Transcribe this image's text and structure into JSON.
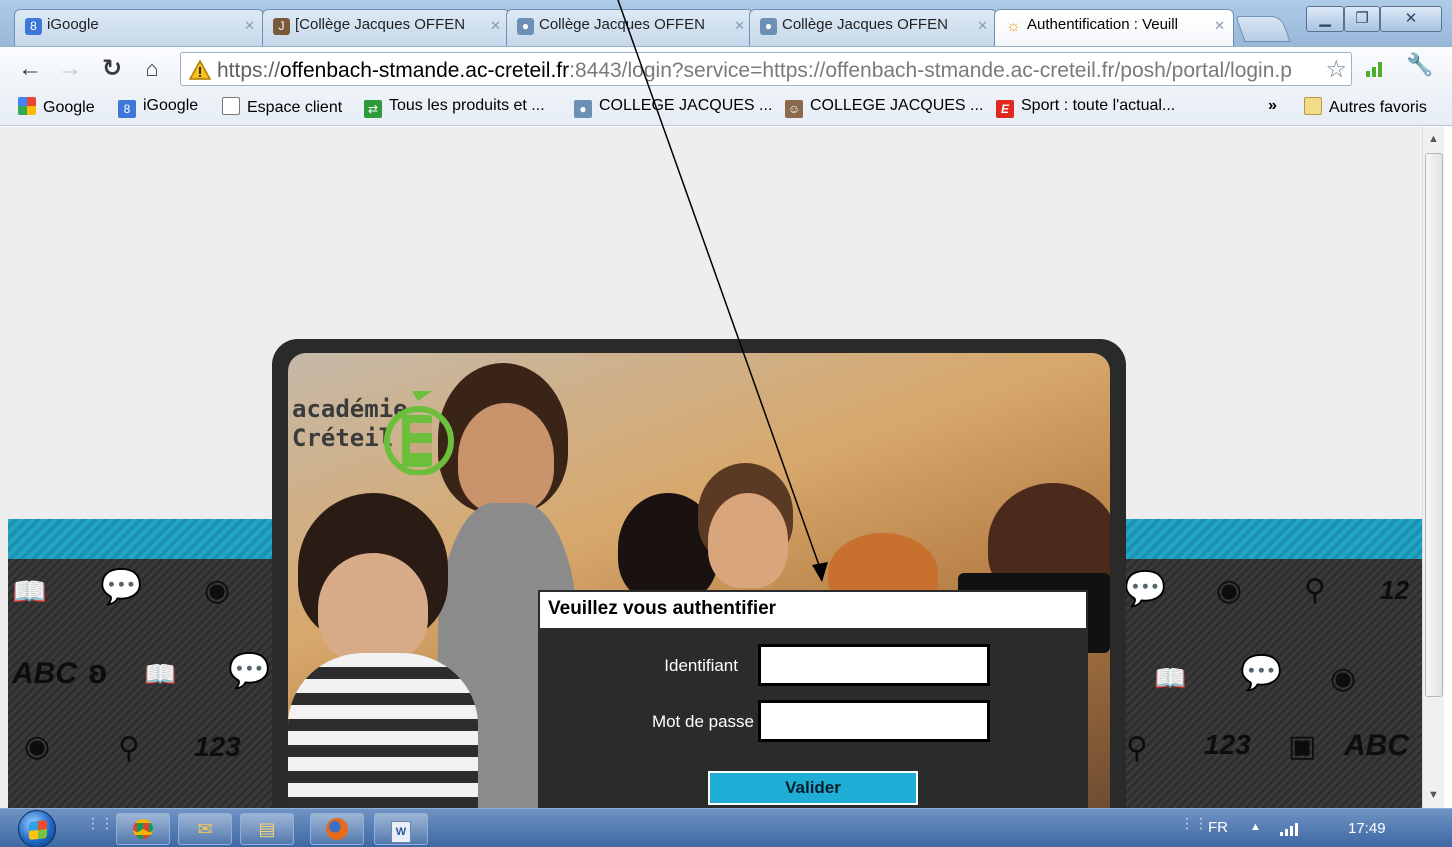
{
  "tabs": [
    {
      "label": "iGoogle",
      "icon": "google-8-icon",
      "color": "#3d78d8"
    },
    {
      "label": "[Collège Jacques OFFEN",
      "icon": "college-logo-icon",
      "color": "#7a5a3a"
    },
    {
      "label": "Collège Jacques OFFEN",
      "icon": "owl-icon",
      "color": "#6b8fb5"
    },
    {
      "label": "Collège Jacques OFFEN",
      "icon": "owl-icon",
      "color": "#6b8fb5"
    },
    {
      "label": "Authentification : Veuill",
      "icon": "loading-sun-icon",
      "color": "#f0a020",
      "active": true
    }
  ],
  "toolbar": {
    "url_scheme": "https://",
    "url_host": "offenbach-stmande.ac-creteil.fr",
    "url_rest": ":8443/login?service=https://offenbach-stmande.ac-creteil.fr/posh/portal/login.p"
  },
  "bookmarks": [
    {
      "label": "Google",
      "icon": "google-puzzle-icon",
      "color": "#4285f4"
    },
    {
      "label": "iGoogle",
      "icon": "google-8-icon",
      "color": "#3d78d8"
    },
    {
      "label": "Espace client",
      "icon": "page-icon",
      "color": "#ffffff"
    },
    {
      "label": "Tous les produits et ...",
      "icon": "green-arrows-icon",
      "color": "#2e9a3c"
    },
    {
      "label": "COLLEGE JACQUES ...",
      "icon": "owl-icon",
      "color": "#6b8fb5"
    },
    {
      "label": "COLLEGE JACQUES ...",
      "icon": "mascot-icon",
      "color": "#8a6a4a"
    },
    {
      "label": "Sport : toute l'actual...",
      "icon": "lequipe-e-icon",
      "color": "#e0281e"
    }
  ],
  "bookmarks_overflow": "»",
  "other_bookmarks": "Autres favoris",
  "logo": {
    "line1": "académie",
    "line2": "Créteil",
    "letter": "E",
    "color": "#6cbf3a"
  },
  "login": {
    "title": "Veuillez vous authentifier",
    "username_label": "Identifiant",
    "password_label": "Mot de passe",
    "username_value": "",
    "password_value": "",
    "submit_label": "Valider",
    "button_color": "#1eaed6"
  },
  "taskbar": {
    "items": [
      "chrome-icon",
      "outlook-icon",
      "file-explorer-icon",
      "firefox-icon",
      "word-icon"
    ],
    "language": "FR",
    "clock": "17:49"
  },
  "colors": {
    "stripe": "#22a6c6",
    "page_bg": "#eeeeee",
    "card_frame": "#2a2a2a"
  }
}
